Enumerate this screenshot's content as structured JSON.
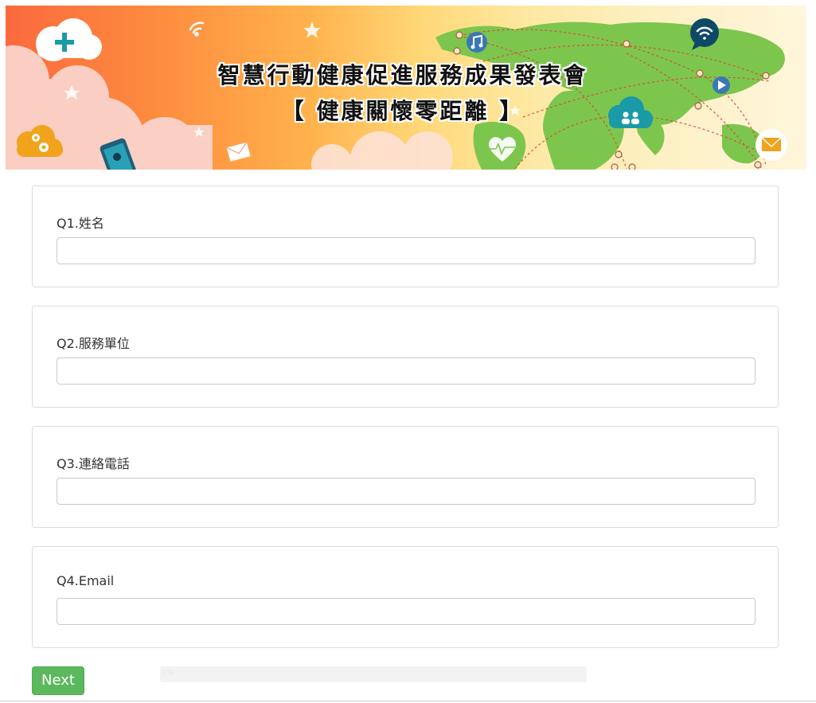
{
  "banner": {
    "title_line1": "智慧行動健康促進服務成果發表會",
    "title_line2": "【 健康關懷零距離 】",
    "icons": [
      "plus-cloud-icon",
      "wifi-icon",
      "star-icon",
      "gear-cloud-icon",
      "phone-location-icon",
      "envelope-icon",
      "music-note-icon",
      "wifi-bubble-icon",
      "play-icon",
      "people-cloud-icon",
      "heartbeat-icon",
      "mail-icon",
      "world-map"
    ]
  },
  "questions": [
    {
      "label": "Q1.姓名",
      "value": "",
      "placeholder": ""
    },
    {
      "label": "Q2.服務單位",
      "value": "",
      "placeholder": ""
    },
    {
      "label": "Q3.連絡電話",
      "value": "",
      "placeholder": ""
    },
    {
      "label": "Q4.Email",
      "value": "",
      "placeholder": ""
    }
  ],
  "footer": {
    "next_label": "Next",
    "progress_percent": 0,
    "progress_text": "0%"
  },
  "colors": {
    "next_button": "#5cb85c",
    "card_border": "#dcdcdc",
    "banner_orange": "#fd8a3e",
    "map_green": "#7dc64e"
  }
}
